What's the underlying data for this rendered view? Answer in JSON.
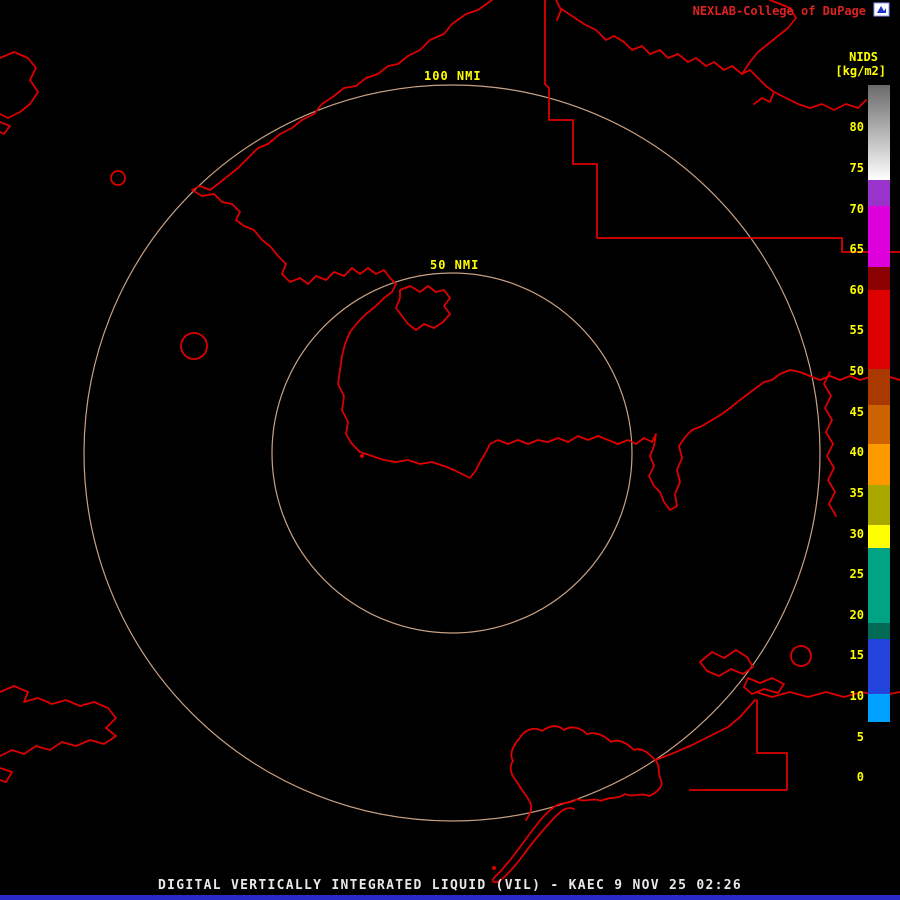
{
  "header": {
    "brand": "NEXLAB-College of DuPage",
    "logo_icon": "cod-page-icon"
  },
  "colorbar": {
    "title": "NIDS",
    "units": "[kg/m2]",
    "ticks": [
      80,
      75,
      70,
      65,
      60,
      55,
      50,
      45,
      40,
      35,
      30,
      25,
      20,
      15,
      10,
      5,
      0
    ],
    "segments": [
      {
        "from": 85.2,
        "to": 73.5,
        "colors": [
          "#6a6a6a",
          "#ffffff"
        ]
      },
      {
        "from": 73.5,
        "to": 70.3,
        "color": "#9933cc"
      },
      {
        "from": 70.3,
        "to": 62.8,
        "color": "#dd00dd"
      },
      {
        "from": 62.8,
        "to": 60.0,
        "color": "#8b0000"
      },
      {
        "from": 60.0,
        "to": 50.3,
        "color": "#dd0000"
      },
      {
        "from": 50.3,
        "to": 45.8,
        "color": "#aa3900"
      },
      {
        "from": 45.8,
        "to": 41.0,
        "color": "#cc6200"
      },
      {
        "from": 41.0,
        "to": 36.0,
        "color": "#ff9900"
      },
      {
        "from": 36.0,
        "to": 31.0,
        "color": "#a8a800"
      },
      {
        "from": 31.0,
        "to": 28.2,
        "color": "#ffff00"
      },
      {
        "from": 28.2,
        "to": 19.0,
        "color": "#00a383"
      },
      {
        "from": 19.0,
        "to": 17.0,
        "color": "#006a55"
      },
      {
        "from": 17.0,
        "to": 10.2,
        "color": "#2244dd"
      },
      {
        "from": 10.2,
        "to": 6.8,
        "color": "#00a0ff"
      },
      {
        "from": 6.8,
        "to": -1.9,
        "color": "#000000"
      }
    ]
  },
  "rings": {
    "outer_label": "100 NMI",
    "inner_label": "50 NMI"
  },
  "footer": {
    "title": "DIGITAL VERTICALLY INTEGRATED LIQUID (VIL) - KAEC 9 NOV 25 02:26"
  },
  "colors": {
    "background": "#000000",
    "map_line": "#dd0000",
    "ring": "#c8a184",
    "label_yellow": "#ffff00",
    "brand_red": "#dd2222",
    "footer_text": "#e8e8e8",
    "bottom_bar_blue": "#2929c8"
  }
}
